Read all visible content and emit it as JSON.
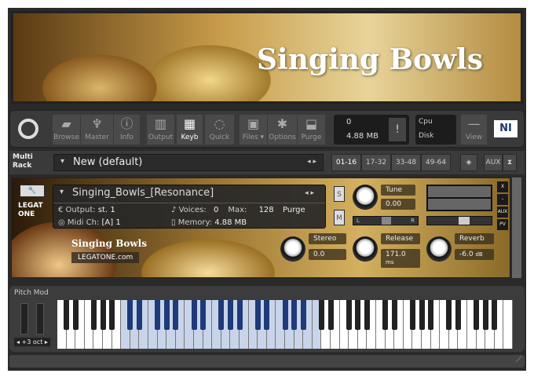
{
  "banner": {
    "title": "Singing Bowls"
  },
  "toolbar": {
    "buttons": [
      {
        "label": "Browse",
        "icon": "folder-icon"
      },
      {
        "label": "Master",
        "icon": "metronome-icon"
      },
      {
        "label": "Info",
        "icon": "info-icon"
      },
      {
        "label": "Output",
        "icon": "faders-icon"
      },
      {
        "label": "Keyb",
        "icon": "piano-icon",
        "active": true
      },
      {
        "label": "Quick",
        "icon": "ring-icon"
      },
      {
        "label": "Files ▾",
        "icon": "floppy-icon"
      },
      {
        "label": "Options",
        "icon": "gear-icon"
      },
      {
        "label": "Purge",
        "icon": "purge-icon"
      }
    ],
    "voices": "0",
    "memory": "4.88 MB",
    "alert": "!",
    "cpu": "Cpu",
    "disk": "Disk",
    "view": "View",
    "logo": "NI"
  },
  "rack": {
    "label1": "Multi",
    "label2": "Rack",
    "preset": "New (default)",
    "pages": [
      "01-16",
      "17-32",
      "33-48",
      "49-64"
    ],
    "aux": "AUX"
  },
  "instrument": {
    "name": "Singing_Bowls_[Resonance]",
    "output_label": "Output:",
    "output": "st. 1",
    "midi_label": "Midi Ch:",
    "midi": "[A] 1",
    "voices_label": "Voices:",
    "voices": "0",
    "max_label": "Max:",
    "max": "128",
    "memory_label": "Memory:",
    "memory": "4.88 MB",
    "purge": "Purge",
    "solo": "S",
    "mute": "M",
    "tune_label": "Tune",
    "tune": "0.00",
    "pan_l": "L",
    "pan_r": "R",
    "side": [
      "X",
      "–",
      "AUX",
      "PV"
    ],
    "logo": "LEGATONE",
    "product": "Singing Bowls",
    "site": "LEGATONE.com",
    "stereo_label": "Stereo",
    "stereo": "0.0",
    "release_label": "Release",
    "release": "171.0",
    "release_unit": "ms",
    "reverb_label": "Reverb",
    "reverb": "-6.0",
    "reverb_unit": "dB"
  },
  "keyboard": {
    "label": "Pitch Mod",
    "octave": "◂ +3 oct ▸",
    "white_keys": 50,
    "highlight_start": 7,
    "highlight_end": 28
  }
}
